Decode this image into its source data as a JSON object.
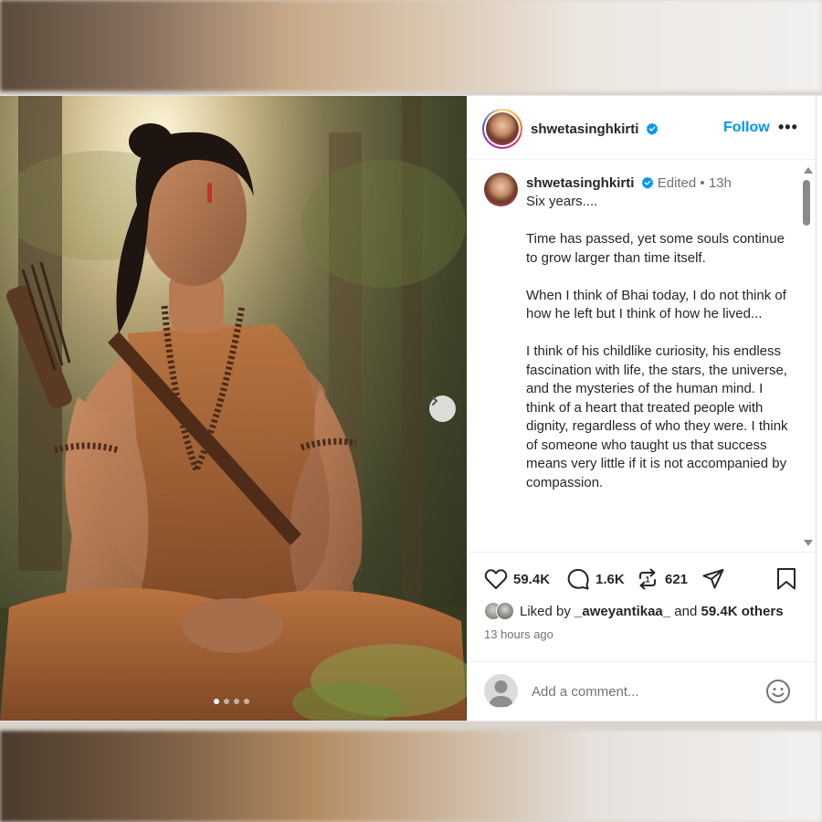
{
  "post": {
    "username": "shwetasinghkirti",
    "follow_label": "Follow",
    "more_label": "•••",
    "carousel": {
      "total_slides": 4,
      "active_slide": 1
    },
    "caption": {
      "username": "shwetasinghkirti",
      "edited_label": "Edited",
      "separator": "•",
      "age": "13h",
      "paragraphs": [
        "Six years....",
        "Time has passed, yet some souls continue to grow larger than time itself.",
        "When I think of Bhai today, I do not think of how he left but I think of how he lived...",
        "I think of his childlike curiosity, his endless fascination with life, the stars, the universe, and the mysteries of the human mind. I think of a heart that treated people with dignity, regardless of who they were. I think of someone who taught us that success means very little if it is not accompanied by compassion."
      ]
    },
    "actions": {
      "likes": "59.4K",
      "comments": "1.6K",
      "reposts": "621"
    },
    "liked_by": {
      "prefix": "Liked by",
      "user": "_aweyantikaa_",
      "connector": "and",
      "others": "59.4K others"
    },
    "time_ago": "13 hours ago",
    "comment_box": {
      "placeholder": "Add a comment..."
    },
    "colors": {
      "accent": "#0095f6",
      "text": "#262626",
      "muted": "#737373",
      "verified": "#0095f6"
    },
    "icons": [
      "verified-icon",
      "heart-icon",
      "comment-icon",
      "repost-icon",
      "share-icon",
      "bookmark-icon",
      "chevron-right-icon",
      "emoji-icon",
      "user-icon"
    ]
  }
}
